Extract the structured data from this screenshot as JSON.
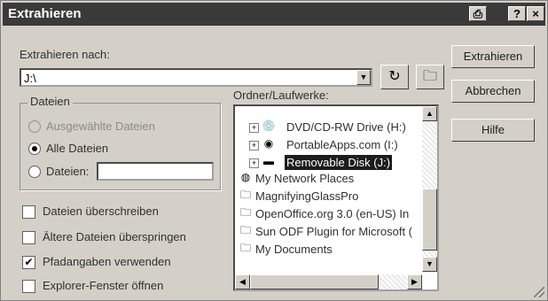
{
  "window": {
    "title": "Extrahieren",
    "help_symbol": "?",
    "close_symbol": "×"
  },
  "extract_to": {
    "label": "Extrahieren nach:",
    "value": "J:\\"
  },
  "buttons": {
    "extract": "Extrahieren",
    "cancel": "Abbrechen",
    "help": "Hilfe"
  },
  "files_group": {
    "label": "Dateien",
    "options": [
      "Ausgewählte Dateien",
      "Alle Dateien",
      "Dateien:"
    ],
    "selected": "Alle Dateien",
    "files_field_value": ""
  },
  "checkboxes": [
    {
      "label": "Dateien überschreiben",
      "checked": false
    },
    {
      "label": "Ältere Dateien überspringen",
      "checked": false
    },
    {
      "label": "Pfadangaben verwenden",
      "checked": true
    },
    {
      "label": "Explorer-Fenster öffnen",
      "checked": false
    }
  ],
  "folder_tree": {
    "label": "Ordner/Laufwerke:",
    "items": [
      "DVD/CD-RW Drive (H:)",
      "PortableApps.com (I:)",
      "Removable Disk (J:)",
      "My Network Places",
      "MagnifyingGlassPro",
      "OpenOffice.org 3.0 (en-US) In",
      "Sun ODF Plugin for Microsoft (",
      "My Documents"
    ],
    "selected": "Removable Disk (J:)"
  }
}
